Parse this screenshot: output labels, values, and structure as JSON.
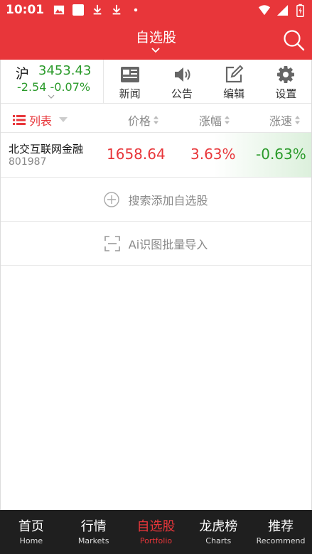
{
  "status_bar": {
    "time": "10:01"
  },
  "header": {
    "title": "自选股"
  },
  "index": {
    "name": "沪",
    "value": "3453.43",
    "change": "-2.54",
    "change_pct": "-0.07%"
  },
  "toolbar": {
    "items": [
      {
        "label": "新闻",
        "icon": "news-icon"
      },
      {
        "label": "公告",
        "icon": "speaker-icon"
      },
      {
        "label": "编辑",
        "icon": "edit-icon"
      },
      {
        "label": "设置",
        "icon": "gear-icon"
      }
    ]
  },
  "columns": {
    "list_label": "列表",
    "price": "价格",
    "pct": "涨幅",
    "speed": "涨速"
  },
  "stocks": [
    {
      "name": "北交互联网金融",
      "code": "801987",
      "price": "1658.64",
      "pct": "3.63%",
      "speed": "-0.63%"
    }
  ],
  "actions": {
    "add_label": "搜索添加自选股",
    "ai_label": "Ai识图批量导入"
  },
  "bottom_nav": {
    "items": [
      {
        "cn": "首页",
        "en": "Home",
        "active": false
      },
      {
        "cn": "行情",
        "en": "Markets",
        "active": false
      },
      {
        "cn": "自选股",
        "en": "Portfolio",
        "active": true
      },
      {
        "cn": "龙虎榜",
        "en": "Charts",
        "active": false
      },
      {
        "cn": "推荐",
        "en": "Recommend",
        "active": false
      }
    ]
  },
  "colors": {
    "brand_red": "#e8363a",
    "up_red": "#e8363a",
    "down_green": "#2a9a2a",
    "nav_bg": "#1f1f1f"
  }
}
